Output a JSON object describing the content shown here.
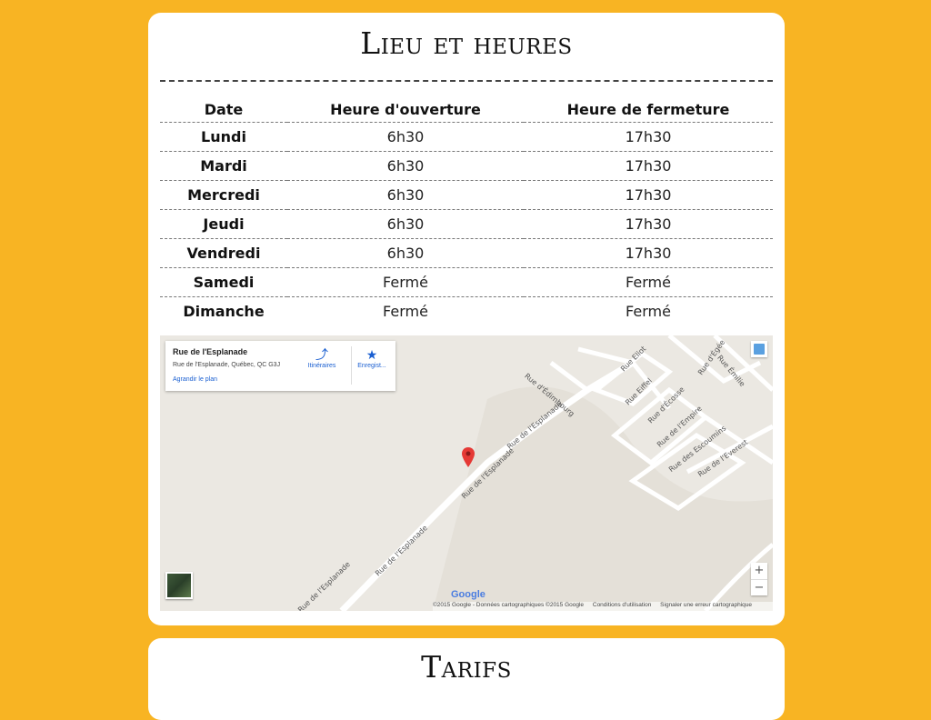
{
  "hours_card": {
    "title": "Lieu et heures",
    "columns": [
      "Date",
      "Heure d'ouverture",
      "Heure de fermeture"
    ],
    "rows": [
      {
        "day": "Lundi",
        "open": "6h30",
        "close": "17h30"
      },
      {
        "day": "Mardi",
        "open": "6h30",
        "close": "17h30"
      },
      {
        "day": "Mercredi",
        "open": "6h30",
        "close": "17h30"
      },
      {
        "day": "Jeudi",
        "open": "6h30",
        "close": "17h30"
      },
      {
        "day": "Vendredi",
        "open": "6h30",
        "close": "17h30"
      },
      {
        "day": "Samedi",
        "open": "Fermé",
        "close": "Fermé"
      },
      {
        "day": "Dimanche",
        "open": "Fermé",
        "close": "Fermé"
      }
    ]
  },
  "map": {
    "info": {
      "title": "Rue de l'Esplanade",
      "address": "Rue de l'Esplanade, Québec, QC G3J",
      "enlarge_link": "Agrandir le plan",
      "directions_label": "Itinéraires",
      "save_label": "Enregist..."
    },
    "street_labels": {
      "esplanade_1": "Rue de l'Esplanade",
      "esplanade_2": "Rue de l'Esplanade",
      "esplanade_3": "Rue de l'Esplanade",
      "esplanade_4": "Rue de l'Esplanade",
      "edimbourg": "Rue d'Édimbourg",
      "eliot": "Rue Eliot",
      "eiffel": "Rue Eiffel",
      "ecosse": "Rue d'Écosse",
      "empire": "Rue de l'Empire",
      "escoumins": "Rue des Escoumins",
      "everest": "Rue de l'Everest",
      "egee": "Rue d'Égée",
      "emilie": "Rue Émilie"
    },
    "zoom_in": "+",
    "zoom_out": "−",
    "google_logo": "Google",
    "footer": {
      "copyright": "©2015 Google - Données cartographiques ©2015 Google",
      "terms": "Conditions d'utilisation",
      "report": "Signaler une erreur cartographique"
    },
    "colors": {
      "background": "#ebe8e2",
      "road": "#ffffff",
      "marker": "#e53935"
    }
  },
  "tarifs_card": {
    "title": "Tarifs"
  },
  "colors": {
    "page_background": "#f8b423",
    "card": "#ffffff"
  }
}
